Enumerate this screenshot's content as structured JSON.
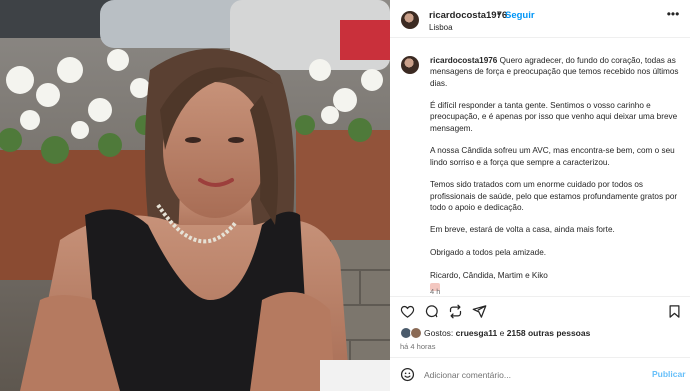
{
  "post": {
    "username": "ricardocosta1976",
    "separator": "•",
    "follow_label": "Seguir",
    "location": "Lisboa",
    "more_icon": "more-horizontal-icon"
  },
  "caption": {
    "username": "ricardocosta1976",
    "paragraphs": [
      "Quero agradecer, do fundo do coração, todas as mensagens de força e preocupação que temos recebido nos últimos dias.",
      "É difícil responder a tanta gente. Sentimos o vosso carinho e preocupação, e é apenas por isso que venho aqui deixar uma breve mensagem.",
      "A nossa Cândida sofreu um AVC, mas encontra-se bem, com o seu lindo sorriso e a força que sempre a caracterizou.",
      "Temos sido tratados com um enorme cuidado por todos os profissionais de saúde, pelo que estamos profundamente gratos por todo o apoio e dedicação.",
      "Em breve, estará de volta a casa, ainda mais forte.",
      "Obrigado a todos pela amizade.",
      "Ricardo, Cândida, Martim e Kiko"
    ],
    "time": "4 h"
  },
  "actions": {
    "like_icon": "heart-icon",
    "comment_icon": "comment-icon",
    "repost_icon": "repost-icon",
    "share_icon": "share-icon",
    "save_icon": "bookmark-icon"
  },
  "likes": {
    "prefix": "Gostos: ",
    "user": "cruesga11",
    "connector": " e ",
    "others": "2158 outras pessoas"
  },
  "post_time": "há 4 horas",
  "comment_box": {
    "placeholder": "Adicionar comentário...",
    "post_label": "Publicar",
    "emoji_icon": "smiley-icon"
  },
  "colors": {
    "accent": "#0095f6",
    "text": "#262626",
    "muted": "#737373",
    "divider": "#efefef"
  }
}
